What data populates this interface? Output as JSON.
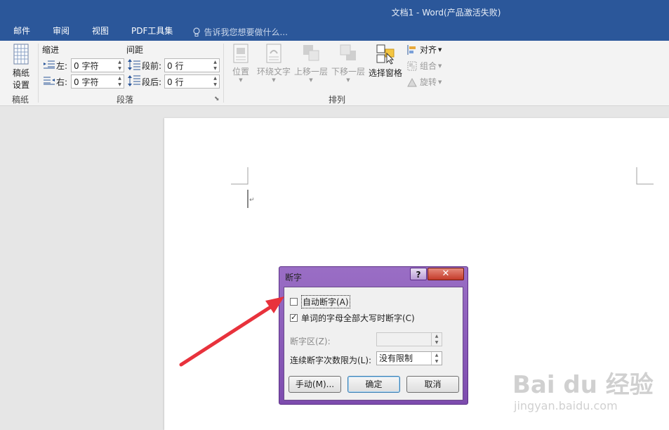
{
  "window": {
    "title": "文档1 - Word(产品激活失败)"
  },
  "tabs": [
    "邮件",
    "审阅",
    "视图",
    "PDF工具集"
  ],
  "tell_me": "告诉我您想要做什么...",
  "ribbon": {
    "gaozhi": {
      "button": [
        "稿纸",
        "设置"
      ],
      "group_label": "稿纸"
    },
    "paragraph": {
      "indent_label": "缩进",
      "spacing_label": "间距",
      "left_label": "左:",
      "left_value": "0 字符",
      "right_label": "右:",
      "right_value": "0 字符",
      "before_label": "段前:",
      "before_value": "0 行",
      "after_label": "段后:",
      "after_value": "0 行",
      "group_label": "段落"
    },
    "arrange": {
      "position": "位置",
      "wrap_text": "环绕文字",
      "bring_forward": "上移一层",
      "send_backward": "下移一层",
      "selection_pane": "选择窗格",
      "align": "对齐",
      "group": "组合",
      "rotate": "旋转",
      "group_label": "排列"
    }
  },
  "dialog": {
    "title": "断字",
    "help": "?",
    "auto_hyphenate": {
      "label": "自动断字(A)",
      "checked": false
    },
    "hyphenate_caps": {
      "label": "单词的字母全部大写时断字(C)",
      "checked": true
    },
    "zone_label": "断字区(Z):",
    "zone_value": "",
    "limit_label": "连续断字次数限为(L):",
    "limit_value": "没有限制",
    "manual_button": "手动(M)...",
    "ok_button": "确定",
    "cancel_button": "取消"
  },
  "watermark": {
    "brand": "Bai du 经验",
    "url": "jingyan.baidu.com"
  },
  "colors": {
    "title_bar": "#2b579a",
    "dialog_frame": "#8a5cba",
    "annotation_arrow": "#e8323c"
  }
}
